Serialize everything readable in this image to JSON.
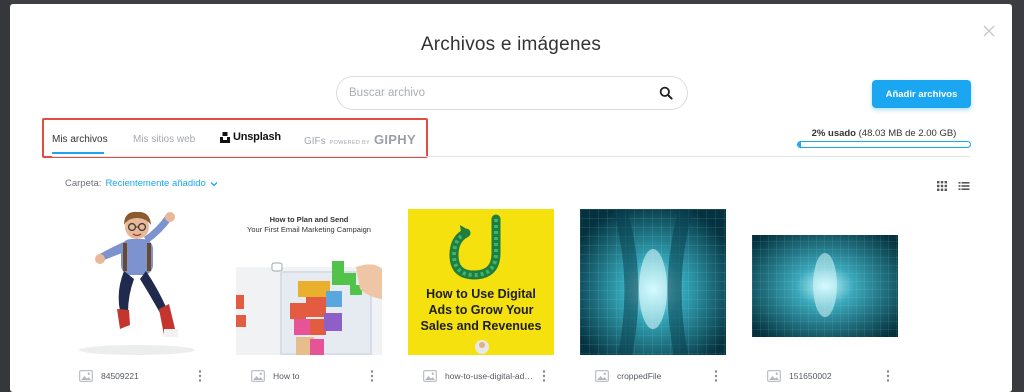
{
  "modal": {
    "title": "Archivos e imágenes"
  },
  "search": {
    "placeholder": "Buscar archivo",
    "icon": "search-icon"
  },
  "actions": {
    "add_label": "Añadir archivos",
    "accent": "#1aa6f0"
  },
  "tabs": {
    "mis_archivos": "Mis archivos",
    "mis_sitios": "Mis sitios web",
    "unsplash": "Unsplash",
    "gifs": "GIFs",
    "powered_by": "POWERED BY",
    "giphy": "GIPHY",
    "highlight_color": "#e24d43"
  },
  "usage": {
    "used": "2% usado",
    "detail": "(48.03 MB de 2.00 GB)",
    "percent": 2
  },
  "folder": {
    "label": "Carpeta:",
    "value": "Recientemente añadido"
  },
  "views": [
    "grid-view-icon",
    "list-view-icon"
  ],
  "files": [
    {
      "name": "84509221"
    },
    {
      "name": "How to",
      "blog_title": "How to Plan and Send",
      "blog_subtitle": "Your First Email Marketing Campaign"
    },
    {
      "name": "how-to-use-digital-ads...",
      "ads_title": "How to Use Digital Ads to Grow Your Sales and Revenues"
    },
    {
      "name": "croppedFile"
    },
    {
      "name": "151650002"
    }
  ]
}
